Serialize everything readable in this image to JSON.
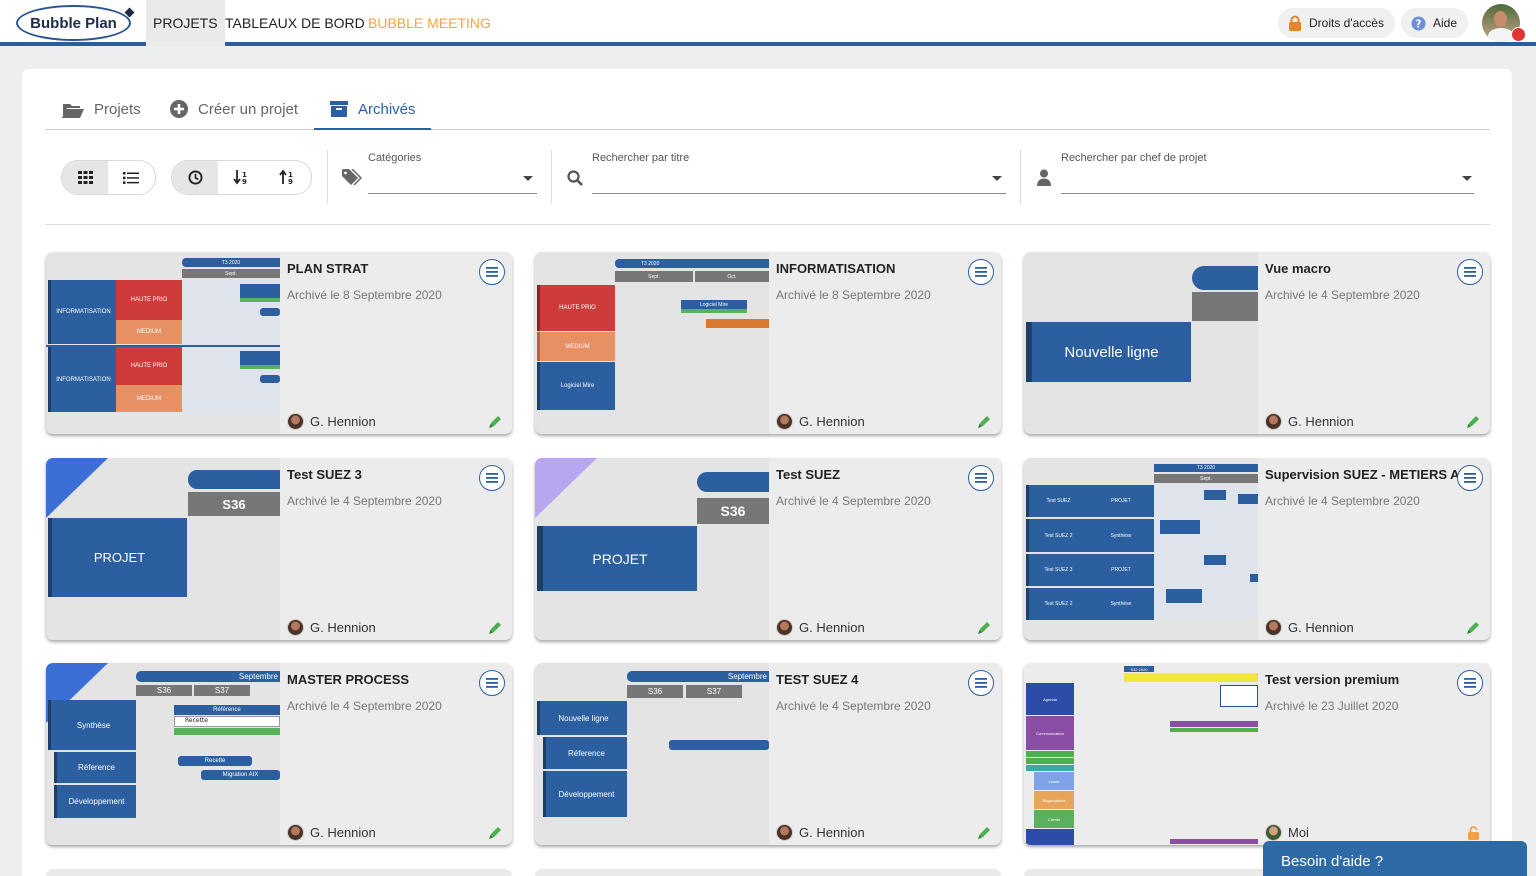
{
  "header": {
    "logo": "Bubble Plan",
    "nav": [
      {
        "label": "PROJETS",
        "active": true
      },
      {
        "label": "TABLEAUX DE BORD",
        "active": false
      },
      {
        "label": "BUBBLE MEETING",
        "active": false
      }
    ],
    "access_label": "Droits d'accès",
    "help_label": "Aide",
    "brand_color": "#2a5f9e",
    "accent_orange": "#f5a442"
  },
  "tabs": [
    {
      "label": "Projets",
      "icon": "folder-open-icon"
    },
    {
      "label": "Créer un projet",
      "icon": "plus-circle-icon"
    },
    {
      "label": "Archivés",
      "icon": "archive-icon",
      "active": true
    }
  ],
  "filters": {
    "categories_label": "Catégories",
    "title_label": "Rechercher par titre",
    "manager_label": "Rechercher par chef de projet"
  },
  "cards": [
    {
      "title": "PLAN STRAT",
      "date": "Archivé le 8 Septembre 2020",
      "owner": "G. Hennion",
      "action_icon": "pencil-icon"
    },
    {
      "title": "INFORMATISATION",
      "date": "Archivé le 8 Septembre 2020",
      "owner": "G. Hennion",
      "action_icon": "pencil-icon"
    },
    {
      "title": "Vue macro",
      "date": "Archivé le 4 Septembre 2020",
      "owner": "G. Hennion",
      "action_icon": "pencil-icon"
    },
    {
      "title": "Test SUEZ 3",
      "date": "Archivé le 4 Septembre 2020",
      "owner": "G. Hennion",
      "action_icon": "pencil-icon"
    },
    {
      "title": "Test SUEZ",
      "date": "Archivé le 4 Septembre 2020",
      "owner": "G. Hennion",
      "action_icon": "pencil-icon"
    },
    {
      "title": "Supervision SUEZ - METIERS A",
      "date": "Archivé le 4 Septembre 2020",
      "owner": "G. Hennion",
      "action_icon": "pencil-icon"
    },
    {
      "title": "MASTER PROCESS",
      "date": "Archivé le 4 Septembre 2020",
      "owner": "G. Hennion",
      "action_icon": "pencil-icon"
    },
    {
      "title": "TEST SUEZ 4",
      "date": "Archivé le 4 Septembre 2020",
      "owner": "G. Hennion",
      "action_icon": "pencil-icon"
    },
    {
      "title": "Test version premium",
      "date": "Archivé le 23 Juillet 2020",
      "owner": "Moi",
      "action_icon": "unlock-icon"
    }
  ],
  "previews": {
    "p1": {
      "period": "T3 2020",
      "month": "Sept.",
      "rows": [
        "INFORMATISATION",
        "INFORMATISATION"
      ],
      "subrows": [
        "HAUTE PRIO",
        "MEDIUM",
        "HAUTE PRIO",
        "MEDIUM"
      ]
    },
    "p2": {
      "period": "T3 2020",
      "months": [
        "Sept.",
        "Oct."
      ],
      "rows": [
        "HAUTE PRIO",
        "MEDIUM",
        "Logiciel Mire"
      ],
      "task": "Logiciel Mire"
    },
    "p3": {
      "line": "Nouvelle ligne"
    },
    "p4": {
      "week": "S36",
      "row": "PROJET"
    },
    "p5": {
      "week": "S36",
      "row": "PROJET"
    },
    "p6": {
      "period": "T3 2020",
      "month": "Sept.",
      "rows": [
        "Test SUEZ",
        "Test SUEZ 2",
        "Test SUEZ 3",
        "Test SUEZ 2"
      ],
      "subrows": [
        "PROJET",
        "Synthèse",
        "PROJET",
        "Synthèse"
      ]
    },
    "p7": {
      "month": "Septembre",
      "weeks": [
        "S36",
        "S37"
      ],
      "rows": [
        "Synthèse",
        "Réference",
        "Développement"
      ],
      "tasks": [
        "Référence",
        "Recette",
        "Recette",
        "Migration AIX"
      ]
    },
    "p8": {
      "month": "Septembre",
      "weeks": [
        "S36",
        "S37"
      ],
      "rows": [
        "Nouvelle ligne",
        "Réference",
        "Développement"
      ]
    },
    "p9": {
      "period": "S32 2020",
      "rows": [
        "Agenda",
        "Communication",
        "Leads",
        "Négociations",
        "Clients"
      ]
    }
  },
  "help_widget": "Besoin d'aide ?"
}
